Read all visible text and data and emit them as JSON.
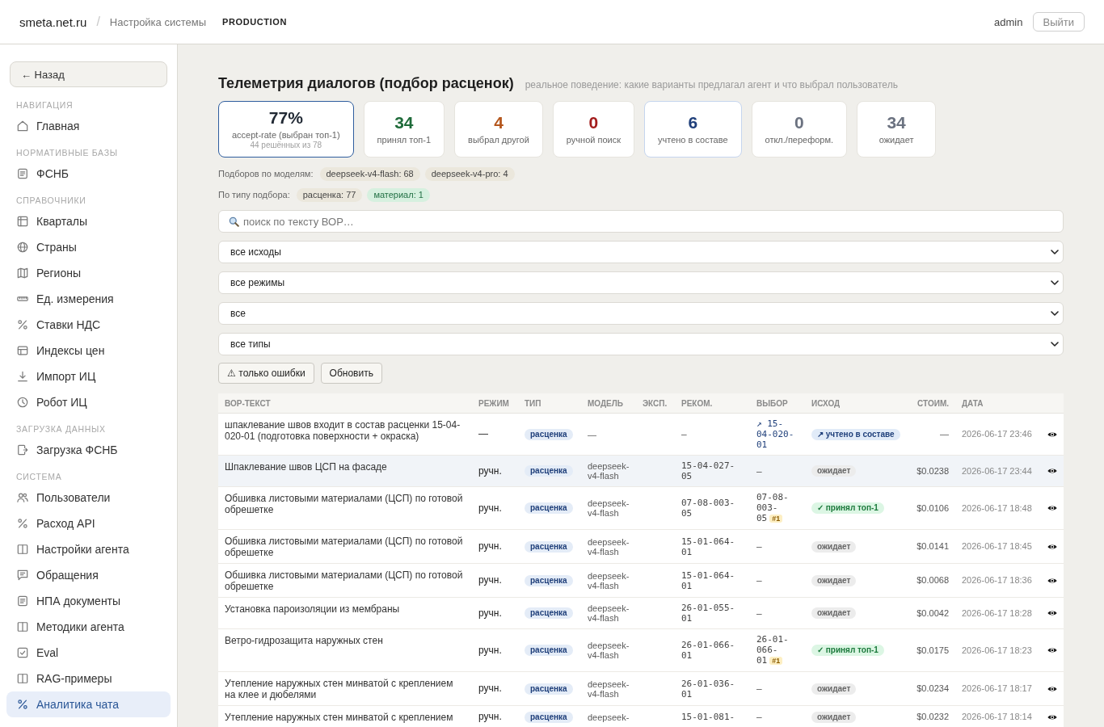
{
  "header": {
    "brand": "smeta.net.ru",
    "separator": "/",
    "section": "Настройка системы",
    "environment": "PRODUCTION",
    "user": "admin",
    "logout": "Выйти"
  },
  "sidebar": {
    "back": "← Назад",
    "groups": [
      {
        "title": "НАВИГАЦИЯ",
        "items": [
          {
            "label": "Главная",
            "selected": false
          }
        ]
      },
      {
        "title": "НОРМАТИВНЫЕ БАЗЫ",
        "items": [
          {
            "label": "ФСНБ",
            "selected": false
          }
        ]
      },
      {
        "title": "СПРАВОЧНИКИ",
        "items": [
          {
            "label": "Кварталы",
            "selected": false
          },
          {
            "label": "Страны",
            "selected": false
          },
          {
            "label": "Регионы",
            "selected": false
          },
          {
            "label": "Ед. измерения",
            "selected": false
          },
          {
            "label": "Ставки НДС",
            "selected": false
          },
          {
            "label": "Индексы цен",
            "selected": false
          },
          {
            "label": "Импорт ИЦ",
            "selected": false
          },
          {
            "label": "Робот ИЦ",
            "selected": false
          }
        ]
      },
      {
        "title": "ЗАГРУЗКА ДАННЫХ",
        "items": [
          {
            "label": "Загрузка ФСНБ",
            "selected": false
          }
        ]
      },
      {
        "title": "СИСТЕМА",
        "items": [
          {
            "label": "Пользователи",
            "selected": false
          },
          {
            "label": "Расход API",
            "selected": false
          },
          {
            "label": "Настройки агента",
            "selected": false
          },
          {
            "label": "Обращения",
            "selected": false
          },
          {
            "label": "НПА документы",
            "selected": false
          },
          {
            "label": "Методики агента",
            "selected": false
          },
          {
            "label": "Eval",
            "selected": false
          },
          {
            "label": "RAG-примеры",
            "selected": false
          },
          {
            "label": "Аналитика чата",
            "selected": true
          }
        ]
      }
    ]
  },
  "page": {
    "title": "Телеметрия диалогов (подбор расценок)",
    "subtitle": "реальное поведение: какие варианты предлагал агент и что выбрал пользователь"
  },
  "stats": [
    {
      "value": "77%",
      "label": "accept-rate (выбран топ-1)",
      "note": "44 решённых из 78",
      "color": "#222a35",
      "kind": "primary"
    },
    {
      "value": "34",
      "label": "принял топ-1",
      "color": "#1f6b3a",
      "kind": "plain"
    },
    {
      "value": "4",
      "label": "выбрал другой",
      "color": "#b4561c",
      "kind": "plain"
    },
    {
      "value": "0",
      "label": "ручной поиск",
      "color": "#a31c1c",
      "kind": "plain"
    },
    {
      "value": "6",
      "label": "учтено в составе",
      "color": "#1f3f7a",
      "kind": "info"
    },
    {
      "value": "0",
      "label": "откл./переформ.",
      "color": "#6b7280",
      "kind": "plain"
    },
    {
      "value": "34",
      "label": "ожидает",
      "color": "#6b7280",
      "kind": "plain"
    }
  ],
  "model_counts": {
    "label": "Подборов по моделям:",
    "chips": [
      {
        "text": "deepseek-v4-flash: 68",
        "kind": "neutral"
      },
      {
        "text": "deepseek-v4-pro: 4",
        "kind": "neutral"
      }
    ]
  },
  "type_counts": {
    "label": "По типу подбора:",
    "chips": [
      {
        "text": "расценка: 77",
        "kind": "neutral"
      },
      {
        "text": "материал: 1",
        "kind": "success"
      }
    ]
  },
  "search": {
    "placeholder": "поиск по тексту ВОР…"
  },
  "filters": [
    "все исходы",
    "все режимы",
    "все",
    "все типы"
  ],
  "actions": [
    "⚠ только ошибки",
    "Обновить"
  ],
  "table": {
    "columns": [
      "ВОР-ТЕКСТ",
      "РЕЖИМ",
      "ТИП",
      "МОДЕЛЬ",
      "ЭКСП.",
      "РЕКОМ.",
      "ВЫБОР",
      "ИСХОД",
      "СТОИМ.",
      "ДАТА"
    ],
    "rows": [
      {
        "text": "шпаклевание швов входит в состав расценки 15-04-020-01 (подготовка поверхности + окраска)",
        "mode": "—",
        "type": "расценка",
        "model": "—",
        "recommended": "–",
        "choice": "↗ 15-04-020-01",
        "outcome": {
          "text": "↗ учтено в составе",
          "kind": "counted"
        },
        "cost": "—",
        "date": "2026-06-17 23:46",
        "hovered": false
      },
      {
        "text": "Шпаклевание швов ЦСП на фасаде",
        "mode": "ручн.",
        "type": "расценка",
        "model": "deepseek-v4-flash",
        "recommended": "15-04-027-05",
        "choice": "–",
        "outcome": {
          "text": "ожидает",
          "kind": "pending"
        },
        "cost": "$0.0238",
        "date": "2026-06-17 23:44",
        "hovered": true
      },
      {
        "text": "Обшивка листовыми материалами (ЦСП) по готовой обрешетке",
        "mode": "ручн.",
        "type": "расценка",
        "model": "deepseek-v4-flash",
        "recommended": "07-08-003-05",
        "choice": "07-08-003-05",
        "rank": "#1",
        "outcome": {
          "text": "✓ принял топ-1",
          "kind": "accepted"
        },
        "cost": "$0.0106",
        "date": "2026-06-17 18:48",
        "hovered": false
      },
      {
        "text": "Обшивка листовыми материалами (ЦСП) по готовой обрешетке",
        "mode": "ручн.",
        "type": "расценка",
        "model": "deepseek-v4-flash",
        "recommended": "15-01-064-01",
        "choice": "–",
        "outcome": {
          "text": "ожидает",
          "kind": "pending"
        },
        "cost": "$0.0141",
        "date": "2026-06-17 18:45",
        "hovered": false
      },
      {
        "text": "Обшивка листовыми материалами (ЦСП) по готовой обрешетке",
        "mode": "ручн.",
        "type": "расценка",
        "model": "deepseek-v4-flash",
        "recommended": "15-01-064-01",
        "choice": "–",
        "outcome": {
          "text": "ожидает",
          "kind": "pending"
        },
        "cost": "$0.0068",
        "date": "2026-06-17 18:36",
        "hovered": false
      },
      {
        "text": "Установка пароизоляции из мембраны",
        "mode": "ручн.",
        "type": "расценка",
        "model": "deepseek-v4-flash",
        "recommended": "26-01-055-01",
        "choice": "–",
        "outcome": {
          "text": "ожидает",
          "kind": "pending"
        },
        "cost": "$0.0042",
        "date": "2026-06-17 18:28",
        "hovered": false
      },
      {
        "text": "Ветро-гидрозащита наружных стен",
        "mode": "ручн.",
        "type": "расценка",
        "model": "deepseek-v4-flash",
        "recommended": "26-01-066-01",
        "choice": "26-01-066-01",
        "rank": "#1",
        "outcome": {
          "text": "✓ принял топ-1",
          "kind": "accepted"
        },
        "cost": "$0.0175",
        "date": "2026-06-17 18:23",
        "hovered": false
      },
      {
        "text": "Утепление наружных стен минватой с креплением на клее и дюбелями",
        "mode": "ручн.",
        "type": "расценка",
        "model": "deepseek-v4-flash",
        "recommended": "26-01-036-01",
        "choice": "–",
        "outcome": {
          "text": "ожидает",
          "kind": "pending"
        },
        "cost": "$0.0234",
        "date": "2026-06-17 18:17",
        "hovered": false
      },
      {
        "text": "Утепление наружных стен минватой с креплением",
        "mode": "ручн.",
        "type": "расценка",
        "model": "deepseek-",
        "recommended": "15-01-081-",
        "choice": "–",
        "outcome": {
          "text": "ожидает",
          "kind": "pending"
        },
        "cost": "$0.0232",
        "date": "2026-06-17 18:14",
        "hovered": false
      }
    ]
  }
}
